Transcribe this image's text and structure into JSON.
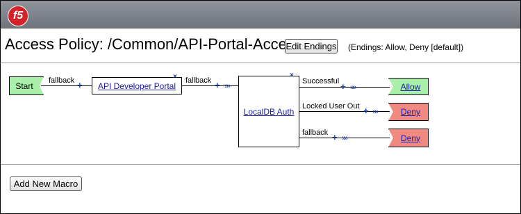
{
  "brand": {
    "logo_text": "f5"
  },
  "header": {
    "title": "Access Policy: /Common/API-Portal-Access",
    "edit_endings_label": "Edit Endings",
    "endings_note": "(Endings: Allow, Deny [default])"
  },
  "flow": {
    "start_label": "Start",
    "edge_fallback_1": "fallback",
    "edge_fallback_2": "fallback",
    "macro_api_portal": "API Developer Portal",
    "localdb_auth": "LocalDB Auth",
    "branches": [
      {
        "label": "Successful",
        "ending": "Allow"
      },
      {
        "label": "Locked User Out",
        "ending": "Deny"
      },
      {
        "label": "fallback",
        "ending": "Deny"
      }
    ],
    "plus_glyph": "+",
    "arrow_glyph": "»»",
    "close_glyph": "×"
  },
  "footer": {
    "add_macro_label": "Add New Macro"
  },
  "colors": {
    "start_green": "#aaf0aa",
    "allow_green": "#aaf0aa",
    "deny_red": "#f08a80",
    "link_blue": "#1a1aa6",
    "topbar": "#7d828b"
  }
}
